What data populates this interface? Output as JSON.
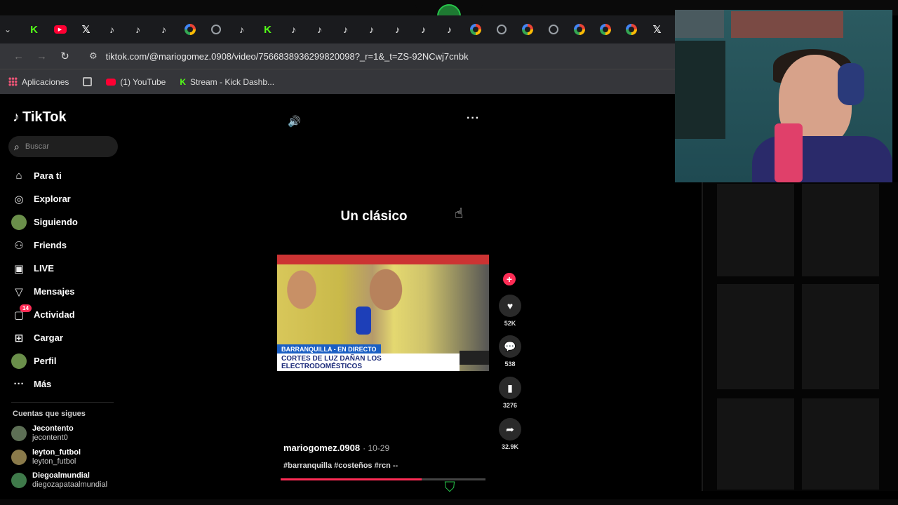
{
  "browser": {
    "url": "tiktok.com/@mariogomez.0908/video/7566838936299820098?_r=1&_t=ZS-92NCwj7cnbk",
    "tabs": [
      {
        "icon": "kick-icon",
        "glyph": "K",
        "kind": "kick"
      },
      {
        "icon": "youtube-icon",
        "glyph": "▶",
        "kind": "yt"
      },
      {
        "icon": "x-icon",
        "glyph": "𝕏",
        "kind": "x"
      },
      {
        "icon": "tiktok-icon",
        "glyph": "♪",
        "kind": "tt"
      },
      {
        "icon": "tiktok-icon",
        "glyph": "♪",
        "kind": "tt"
      },
      {
        "icon": "tiktok-icon",
        "glyph": "♪",
        "kind": "tt"
      },
      {
        "icon": "google-icon",
        "glyph": "",
        "kind": "g"
      },
      {
        "icon": "globe-icon",
        "glyph": "",
        "kind": "globe"
      },
      {
        "icon": "tiktok-icon",
        "glyph": "♪",
        "kind": "tt"
      },
      {
        "icon": "kick-icon",
        "glyph": "K",
        "kind": "kick"
      },
      {
        "icon": "tiktok-icon",
        "glyph": "♪",
        "kind": "tt"
      },
      {
        "icon": "tiktok-icon",
        "glyph": "♪",
        "kind": "tt"
      },
      {
        "icon": "tiktok-icon",
        "glyph": "♪",
        "kind": "tt"
      },
      {
        "icon": "tiktok-icon",
        "glyph": "♪",
        "kind": "tt"
      },
      {
        "icon": "tiktok-icon",
        "glyph": "♪",
        "kind": "tt"
      },
      {
        "icon": "tiktok-icon",
        "glyph": "♪",
        "kind": "tt"
      },
      {
        "icon": "tiktok-icon",
        "glyph": "♪",
        "kind": "tt"
      },
      {
        "icon": "google-icon",
        "glyph": "",
        "kind": "g"
      },
      {
        "icon": "globe-icon",
        "glyph": "",
        "kind": "globe"
      },
      {
        "icon": "google-icon",
        "glyph": "",
        "kind": "g"
      },
      {
        "icon": "globe-icon",
        "glyph": "",
        "kind": "globe"
      },
      {
        "icon": "google-icon",
        "glyph": "",
        "kind": "g"
      },
      {
        "icon": "google-icon",
        "glyph": "",
        "kind": "g"
      },
      {
        "icon": "google-icon",
        "glyph": "",
        "kind": "g"
      },
      {
        "icon": "x-icon",
        "glyph": "𝕏",
        "kind": "x"
      }
    ],
    "bookmarks": {
      "apps": "Aplicaciones",
      "youtube": "(1) YouTube",
      "kick": "Stream - Kick Dashb..."
    }
  },
  "tiktok": {
    "logo": "TikTok",
    "search_placeholder": "Buscar",
    "nav": [
      {
        "label": "Para ti",
        "icon": "home-icon",
        "glyph": "⌂"
      },
      {
        "label": "Explorar",
        "icon": "compass-icon",
        "glyph": "◎"
      },
      {
        "label": "Siguiendo",
        "icon": "avatar",
        "glyph": ""
      },
      {
        "label": "Friends",
        "icon": "friends-icon",
        "glyph": "⚇"
      },
      {
        "label": "LIVE",
        "icon": "live-icon",
        "glyph": "▣"
      },
      {
        "label": "Mensajes",
        "icon": "send-icon",
        "glyph": "▽"
      },
      {
        "label": "Actividad",
        "icon": "inbox-icon",
        "glyph": "▢",
        "badge": "14"
      },
      {
        "label": "Cargar",
        "icon": "upload-icon",
        "glyph": "⊞"
      },
      {
        "label": "Perfil",
        "icon": "avatar",
        "glyph": ""
      },
      {
        "label": "Más",
        "icon": "more-icon",
        "glyph": "···"
      }
    ],
    "following_title": "Cuentas que sigues",
    "following": [
      {
        "name": "Jecontento",
        "handle": "jecontent0"
      },
      {
        "name": "leyton_futbol",
        "handle": "leyton_futbol"
      },
      {
        "name": "Diegoalmundial",
        "handle": "diegozapataalmundial"
      }
    ],
    "video": {
      "overlay_text": "Un clásico",
      "lower_third_top": "BARRANQUILLA - EN DIRECTO",
      "lower_third_main": "CORTES DE LUZ DAÑAN LOS ELECTRODOMÉSTICOS",
      "author": "mariogomez.0908",
      "date": "· 10-29",
      "tags": "#barranquilla #costeños #rcn --",
      "progress": 0.69
    },
    "actions": {
      "likes": "52K",
      "comments": "538",
      "saves": "3276",
      "shares": "32.9K"
    }
  },
  "colors": {
    "accent": "#fe2c55",
    "kick_green": "#53fc18",
    "overlay_green": "#27c34a"
  }
}
